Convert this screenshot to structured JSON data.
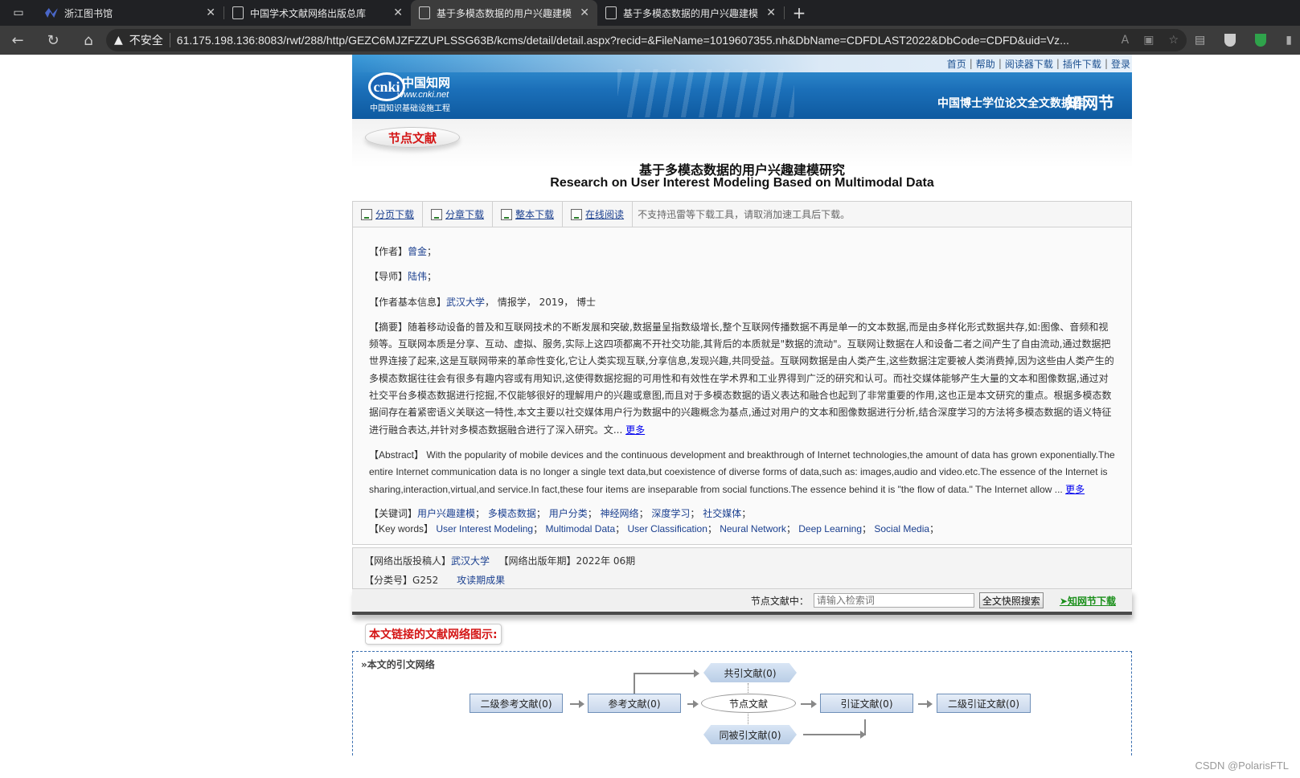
{
  "browser": {
    "tabs": [
      {
        "label": "浙江图书馆",
        "icon": "library-favicon-icon",
        "active": false
      },
      {
        "label": "中国学术文献网络出版总库",
        "icon": "page-icon",
        "active": false
      },
      {
        "label": "基于多模态数据的用户兴趣建模",
        "icon": "page-icon",
        "active": true
      },
      {
        "label": "基于多模态数据的用户兴趣建模",
        "icon": "page-icon",
        "active": false
      }
    ],
    "insecure_label": "不安全",
    "url": "61.175.198.136:8083/rwt/288/http/GEZC6MJZFZZUPLSSG63B/kcms/detail/detail.aspx?recid=&FileName=1019607355.nh&DbName=CDFDLAST2022&DbCode=CDFD&uid=Vz..."
  },
  "top_links": [
    "首页",
    "帮助",
    "阅读器下载",
    "插件下载",
    "登录"
  ],
  "banner": {
    "logo_text": "cnki",
    "logo_cn": "中国知网",
    "logo_url": "www.cnki.net",
    "logo_sub": "中国知识基础设施工程",
    "db_title": "中国博士学位论文全文数据库",
    "db_mark": "知网节"
  },
  "node_badge": "节点文献",
  "title_cn": "基于多模态数据的用户兴趣建模研究",
  "title_en": "Research on User Interest Modeling Based on Multimodal Data",
  "toolbar": {
    "items": [
      "分页下载",
      "分章下载",
      "整本下载",
      "在线阅读"
    ],
    "note": "不支持迅雷等下载工具，请取消加速工具后下载。"
  },
  "details": {
    "author_label": "【作者】",
    "author": "曾金",
    "author_sep": "；",
    "advisor_label": "【导师】",
    "advisor": "陆伟",
    "advisor_sep": "；",
    "info_label": "【作者基本信息】",
    "school": "武汉大学",
    "info_rest": "， 情报学， 2019， 博士",
    "abstract_label": "【摘要】",
    "abstract": "随着移动设备的普及和互联网技术的不断发展和突破,数据量呈指数级增长,整个互联网传播数据不再是单一的文本数据,而是由多样化形式数据共存,如:图像、音频和视频等。互联网本质是分享、互动、虚拟、服务,实际上这四项都离不开社交功能,其背后的本质就是\"数据的流动\"。互联网让数据在人和设备二者之间产生了自由流动,通过数据把世界连接了起来,这是互联网带来的革命性变化,它让人类实现互联,分享信息,发现兴趣,共同受益。互联网数据是由人类产生,这些数据注定要被人类消费掉,因为这些由人类产生的多模态数据往往会有很多有趣内容或有用知识,这使得数据挖掘的可用性和有效性在学术界和工业界得到广泛的研究和认可。而社交媒体能够产生大量的文本和图像数据,通过对社交平台多模态数据进行挖掘,不仅能够很好的理解用户的兴趣或意图,而且对于多模态数据的语义表达和融合也起到了非常重要的作用,这也正是本文研究的重点。根据多模态数据间存在着紧密语义关联这一特性,本文主要以社交媒体用户行为数据中的兴趣概念为基点,通过对用户的文本和图像数据进行分析,结合深度学习的方法将多模态数据的语义特征进行融合表达,并针对多模态数据融合进行了深入研究。文...",
    "more": "更多",
    "abstract_en_label": "【Abstract】",
    "abstract_en": "With the popularity of mobile devices and the continuous development and breakthrough of Internet technologies,the amount of data has grown exponentially.The entire Internet communication data is no longer a single text data,but coexistence of diverse forms of data,such as: images,audio and video.etc.The essence of the Internet is sharing,interaction,virtual,and service.In fact,these four items are inseparable from social functions.The essence behind it is \"the flow of data.\" The Internet allow ...",
    "more_en": "更多",
    "keywords_label": "【关键词】",
    "keywords": [
      "用户兴趣建模",
      "多模态数据",
      "用户分类",
      "神经网络",
      "深度学习",
      "社交媒体"
    ],
    "keywords_en_label": "【Key words】",
    "keywords_en": [
      "User Interest Modeling",
      "Multimodal Data",
      "User Classification",
      "Neural Network",
      "Deep Learning",
      "Social Media"
    ]
  },
  "meta": {
    "publisher_label": "【网络出版投稿人】",
    "publisher": "武汉大学",
    "pubdate_label": "【网络出版年期】",
    "pubdate": "2022年 06期",
    "class_label": "【分类号】",
    "class_no": "G252",
    "achievement": "攻读期成果"
  },
  "search": {
    "label": "节点文献中：",
    "placeholder": "请输入检索词",
    "button": "全文快照搜索",
    "download": "知网节下载"
  },
  "network": {
    "heading": "本文链接的文献网络图示:",
    "subheading": "本文的引文网络",
    "nodes": {
      "co_cited": "共引文献(0)",
      "second_ref": "二级参考文献(0)",
      "ref": "参考文献(0)",
      "center": "节点文献",
      "citing": "引证文献(0)",
      "second_citing": "二级引证文献(0)",
      "co_citing": "同被引文献(0)"
    }
  },
  "watermark": "CSDN @PolarisFTL"
}
